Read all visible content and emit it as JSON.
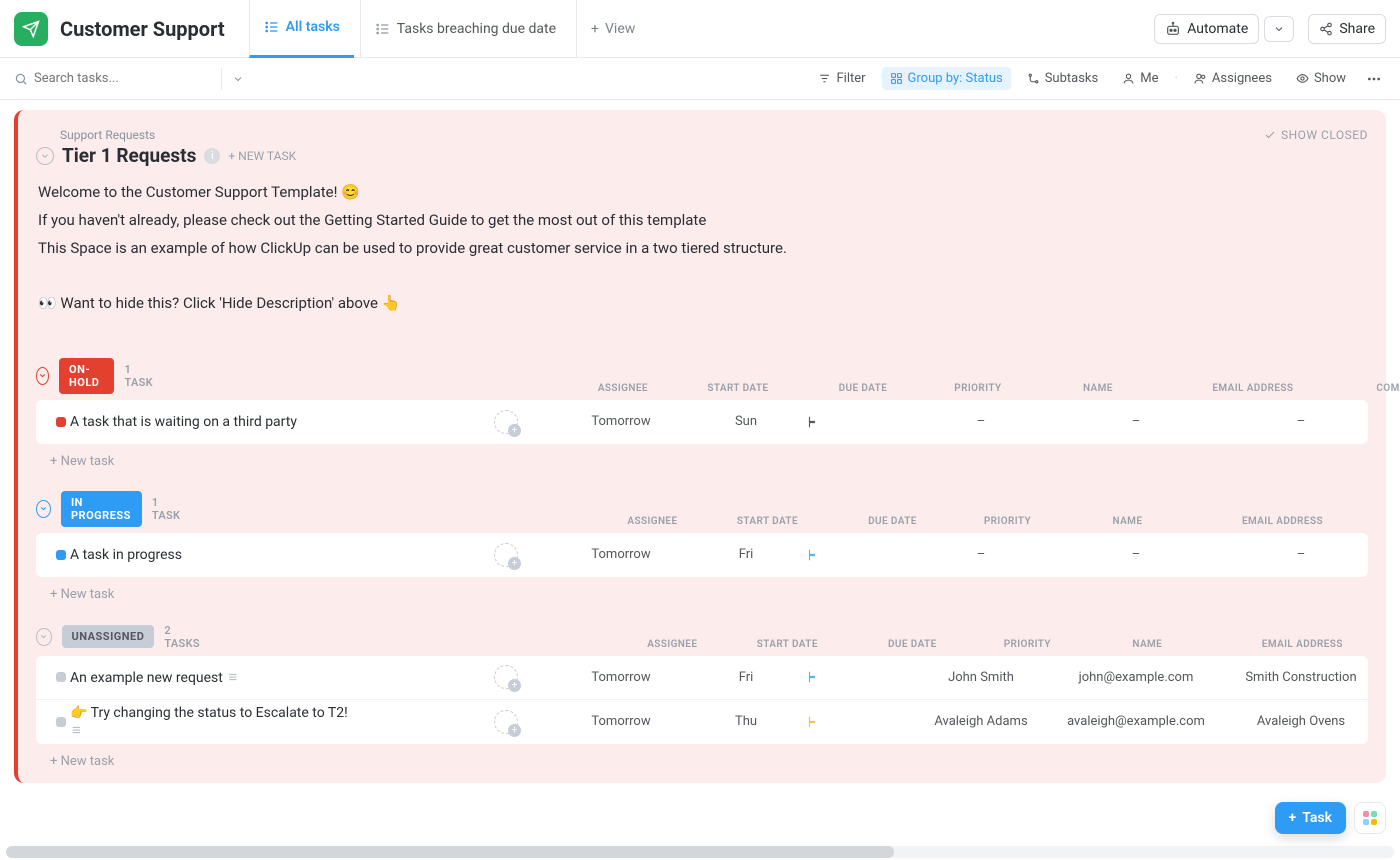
{
  "header": {
    "space_title": "Customer Support",
    "tabs": [
      {
        "label": "All tasks",
        "active": true
      },
      {
        "label": "Tasks breaching due date",
        "active": false
      }
    ],
    "add_view_label": "View",
    "automate_label": "Automate",
    "share_label": "Share"
  },
  "toolbar": {
    "search_placeholder": "Search tasks...",
    "filter_label": "Filter",
    "group_by_label": "Group by: Status",
    "subtasks_label": "Subtasks",
    "me_label": "Me",
    "assignees_label": "Assignees",
    "show_label": "Show"
  },
  "list": {
    "breadcrumb": "Support Requests",
    "title": "Tier 1 Requests",
    "new_task_label": "+ NEW TASK",
    "show_closed_label": "SHOW CLOSED",
    "description_lines": [
      "Welcome to the Customer Support Template! 😊",
      "If you haven't already, please check out the Getting Started Guide to get the most out of this template",
      "This Space is an example of how ClickUp can be used to provide great customer service in a two tiered structure.",
      "",
      "👀 Want to hide this? Click 'Hide Description' above 👆"
    ]
  },
  "columns": {
    "assignee": "ASSIGNEE",
    "start_date": "START DATE",
    "due_date": "DUE DATE",
    "priority": "PRIORITY",
    "name": "NAME",
    "email": "EMAIL ADDRESS",
    "company": "COMPANY NAME"
  },
  "groups": [
    {
      "status_label": "ON-HOLD",
      "pill_class": "pill-onhold",
      "sq_class": "sq-red",
      "collapse_class": "onhold-collapse",
      "count_label": "1 TASK",
      "tasks": [
        {
          "title": "A task that is waiting on a third party",
          "start": "Tomorrow",
          "due": "Sun",
          "flag": "",
          "name": "–",
          "email": "–",
          "company": "–"
        }
      ],
      "new_task_label": "+ New task"
    },
    {
      "status_label": "IN PROGRESS",
      "pill_class": "pill-inprogress",
      "sq_class": "sq-blue",
      "collapse_class": "inprog-collapse",
      "count_label": "1 TASK",
      "tasks": [
        {
          "title": "A task in progress",
          "start": "Tomorrow",
          "due": "Fri",
          "flag": "blue",
          "name": "–",
          "email": "–",
          "company": "–"
        }
      ],
      "new_task_label": "+ New task"
    },
    {
      "status_label": "UNASSIGNED",
      "pill_class": "pill-unassigned",
      "sq_class": "sq-grey",
      "collapse_class": "",
      "count_label": "2 TASKS",
      "tasks": [
        {
          "title": "An example new request",
          "note": "≡",
          "start": "Tomorrow",
          "due": "Fri",
          "flag": "blue",
          "name": "John Smith",
          "email": "john@example.com",
          "company": "Smith Construction"
        },
        {
          "title": "👉 Try changing the status to Escalate to T2!",
          "note_below": "≡",
          "start": "Tomorrow",
          "due": "Thu",
          "flag": "yellow",
          "name": "Avaleigh Adams",
          "email": "avaleigh@example.com",
          "company": "Avaleigh Ovens"
        }
      ],
      "new_task_label": "+ New task"
    }
  ],
  "fab": {
    "label": "Task"
  }
}
